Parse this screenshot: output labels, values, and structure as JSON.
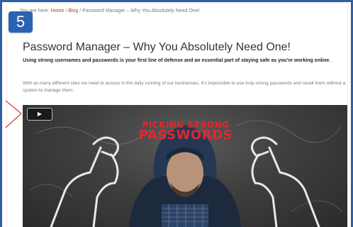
{
  "breadcrumb": {
    "prefix": "You are here:",
    "home": "Home",
    "sep1": "/",
    "blog": "Blog",
    "sep2": "/",
    "current": "Password Manager – Why You Absolutely Need One!"
  },
  "step_badge": "5",
  "article": {
    "title": "Password Manager – Why You Absolutely Need One!",
    "lead": "Using strong usernames and passwords is your first line of defense and an essential part of staying safe as you're working online.",
    "body": "With as many different sites we need to access in the daily running of our businesses, it's impossible to use truly strong passwords and recall them without a system to manage them."
  },
  "video": {
    "play_icon": "play-icon",
    "play_glyph": "▶",
    "headline_line1": "PICKING STRONG",
    "headline_line2": "PASSWORDS"
  },
  "colors": {
    "badge": "#2b63b4",
    "link": "#c0392b",
    "headline": "#e3262e",
    "callout": "#e23a3a"
  }
}
